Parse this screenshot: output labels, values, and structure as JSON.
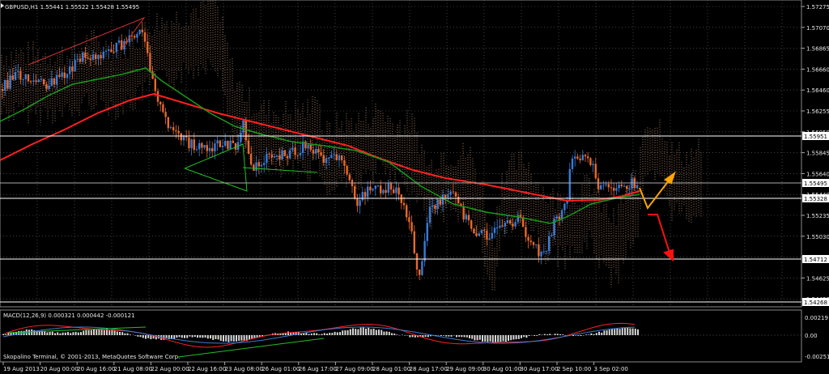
{
  "header": {
    "symbol": "GBPUSD,H1",
    "open": "1.55441",
    "high": "1.55522",
    "low": "1.55428",
    "close": "1.55495"
  },
  "price_axis": {
    "ticks": [
      "1.57275",
      "1.57070",
      "1.56865",
      "1.56660",
      "1.56460",
      "1.56255",
      "1.56050",
      "1.55845",
      "1.55640",
      "1.55440",
      "1.55235",
      "1.55030",
      "1.54825",
      "1.54625",
      "1.54420"
    ],
    "tags": [
      {
        "value": "1.55951",
        "bg": "#ffffff"
      },
      {
        "value": "1.55495",
        "bg": "#ffffff"
      },
      {
        "value": "1.55328",
        "bg": "#ffffff"
      },
      {
        "value": "1.54712",
        "bg": "#ffffff"
      },
      {
        "value": "1.54268",
        "bg": "#ffffff"
      }
    ]
  },
  "macd": {
    "label": "MACD(12,26,9) 0.000321 0.000442 -0.000121",
    "scale_top": "0.00219",
    "scale_mid": "0.00",
    "scale_bottom": "-0.00251"
  },
  "time_axis": {
    "labels": [
      "19 Aug 2013",
      "20 Aug 00:00",
      "20 Aug 16:00",
      "21 Aug 08:00",
      "22 Aug 00:00",
      "22 Aug 16:00",
      "23 Aug 08:00",
      "26 Aug 01:00",
      "26 Aug 17:00",
      "27 Aug 09:00",
      "28 Aug 01:00",
      "28 Aug 17:00",
      "29 Aug 09:00",
      "30 Aug 01:00",
      "30 Aug 17:00",
      "2 Sep 10:00",
      "3 Sep 02:00"
    ]
  },
  "copyright": "Skopalino Terminal, © 2001-2013, MetaQuotes Software Corp.",
  "colors": {
    "background": "#000000",
    "bull_candle": "#3a7bd5",
    "bear_candle": "#e8692a",
    "ma_red": "#ff2020",
    "ma_green": "#1a9a1a",
    "cloud": "#d8a080",
    "arrow_orange": "#ffa500",
    "arrow_red": "#ff1010",
    "grid": "#6a6a6a"
  },
  "icons": [
    "close-arrow-icon"
  ]
}
